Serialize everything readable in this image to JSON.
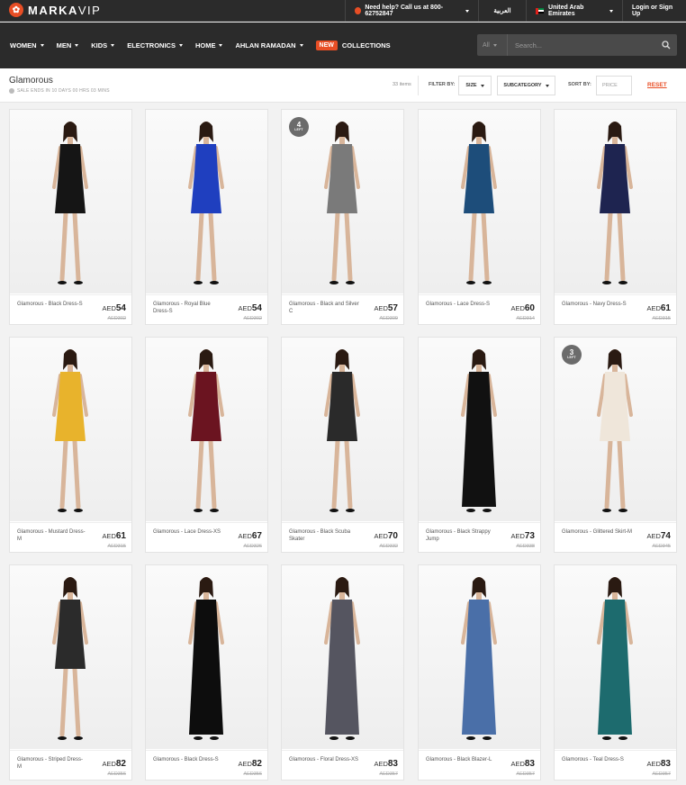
{
  "topbar": {
    "logo_text_bold": "MARKA",
    "logo_text_thin": "VIP",
    "help": "Need help? Call us at 800-62752847",
    "arabic": "العربية",
    "country": "United Arab Emirates",
    "login": "Login or Sign Up"
  },
  "nav": {
    "items": [
      "WOMEN",
      "MEN",
      "KIDS",
      "ELECTRONICS",
      "HOME",
      "AHLAN RAMADAN"
    ],
    "new_badge": "NEW",
    "collections": "COLLECTIONS",
    "search_category": "All",
    "search_placeholder": "Search..."
  },
  "subheader": {
    "title": "Glamorous",
    "sale_ends": "SALE ENDS IN 10 DAYS 00 HRS 03 MINS",
    "items_count": "33 items",
    "filter_by": "FILTER BY:",
    "size": "SIZE",
    "subcategory": "SUBCATEGORY",
    "sort_by": "SORT BY:",
    "price": "PRICE",
    "reset": "RESET"
  },
  "accent_color": "#e84e25",
  "products": [
    {
      "name": "Glamorous - Black Dress-S",
      "currency": "AED",
      "price": "54",
      "old": "AED302",
      "badge": null,
      "dress": "#151515",
      "legs": true
    },
    {
      "name": "Glamorous - Royal Blue Dress-S",
      "currency": "AED",
      "price": "54",
      "old": "AED302",
      "badge": null,
      "dress": "#1f3fbf",
      "legs": true
    },
    {
      "name": "Glamorous - Black and Silver C",
      "currency": "AED",
      "price": "57",
      "old": "AED309",
      "badge": {
        "n": "4",
        "t": "LEFT"
      },
      "dress": "#7a7a7a",
      "legs": true
    },
    {
      "name": "Glamorous - Lace Dress-S",
      "currency": "AED",
      "price": "60",
      "old": "AED314",
      "badge": null,
      "dress": "#1d4d7a",
      "legs": true
    },
    {
      "name": "Glamorous - Navy Dress-S",
      "currency": "AED",
      "price": "61",
      "old": "AED315",
      "badge": null,
      "dress": "#1e2450",
      "legs": true
    },
    {
      "name": "Glamorous - Mustard Dress-M",
      "currency": "AED",
      "price": "61",
      "old": "AED315",
      "badge": null,
      "dress": "#e8b32c",
      "legs": true
    },
    {
      "name": "Glamorous - Lace Dress-XS",
      "currency": "AED",
      "price": "67",
      "old": "AED326",
      "badge": null,
      "dress": "#6b1420",
      "legs": true
    },
    {
      "name": "Glamorous - Black Scuba Skater",
      "currency": "AED",
      "price": "70",
      "old": "AED332",
      "badge": null,
      "dress": "#2a2a2a",
      "legs": true
    },
    {
      "name": "Glamorous - Black Strappy Jump",
      "currency": "AED",
      "price": "73",
      "old": "AED338",
      "badge": null,
      "dress": "#111111",
      "legs": false
    },
    {
      "name": "Glamorous - Glittered Skirt-M",
      "currency": "AED",
      "price": "74",
      "old": "AED345",
      "badge": {
        "n": "3",
        "t": "LEFT"
      },
      "dress": "#efe6da",
      "legs": true
    },
    {
      "name": "Glamorous - Striped Dress-M",
      "currency": "AED",
      "price": "82",
      "old": "AED356",
      "badge": null,
      "dress": "#2b2b2b",
      "legs": true
    },
    {
      "name": "Glamorous - Black Dress-S",
      "currency": "AED",
      "price": "82",
      "old": "AED356",
      "badge": null,
      "dress": "#0d0d0d",
      "legs": false
    },
    {
      "name": "Glamorous - Floral Dress-XS",
      "currency": "AED",
      "price": "83",
      "old": "AED357",
      "badge": null,
      "dress": "#555560",
      "legs": false
    },
    {
      "name": "Glamorous - Black Blazer-L",
      "currency": "AED",
      "price": "83",
      "old": "AED357",
      "badge": null,
      "dress": "#4a6fa8",
      "legs": false
    },
    {
      "name": "Glamorous - Teal Dress-S",
      "currency": "AED",
      "price": "83",
      "old": "AED357",
      "badge": null,
      "dress": "#1d6b6e",
      "legs": false
    }
  ]
}
